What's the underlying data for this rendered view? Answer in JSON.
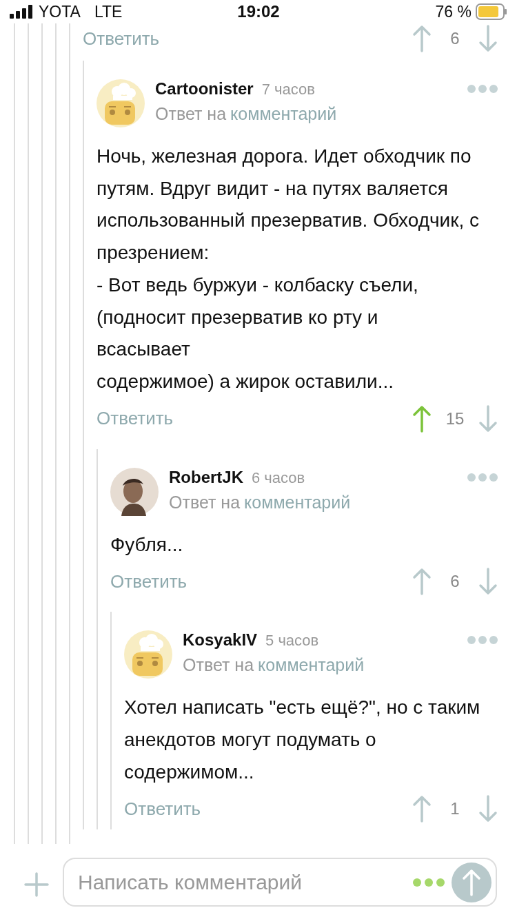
{
  "status_bar": {
    "carrier": "YOTA",
    "network": "LTE",
    "time": "19:02",
    "battery": "76 %"
  },
  "previous_comment_footer": {
    "reply_label": "Ответить",
    "score": "6",
    "upvoted": false
  },
  "comments": [
    {
      "author": "Cartoonister",
      "time": "7 часов",
      "avatar": {
        "kind": "icon"
      },
      "reply_prefix": "Ответ на",
      "reply_link": "комментарий",
      "text": "Ночь, железная дорога. Идет обходчик по путям. Вдруг видит - на путях валяется использованный презерватив. Обходчик, с презрением:\n- Вот ведь буржуи - колбаску съели,\n(подносит презерватив ко рту и\nвсасывает\nсодержимое) а жирок оставили...",
      "reply_label": "Ответить",
      "score": "15",
      "upvoted": true,
      "children": [
        {
          "author": "RobertJK",
          "time": "6 часов",
          "reply_prefix": "Ответ на",
          "reply_link": "комментарий",
          "text": "Фубля...",
          "reply_label": "Ответить",
          "score": "6",
          "upvoted": false,
          "children": [
            {
              "author": "KosyakIV",
              "time": "5 часов",
              "avatar": {
                "kind": "icon"
              },
              "reply_prefix": "Ответ на",
              "reply_link": "комментарий",
              "text": "Хотел написать \"есть ещё?\", но с таким анекдотов могут подумать о содержимом...",
              "reply_label": "Ответить",
              "score": "1",
              "upvoted": false
            }
          ]
        }
      ]
    }
  ],
  "composer": {
    "placeholder": "Написать комментарий"
  }
}
